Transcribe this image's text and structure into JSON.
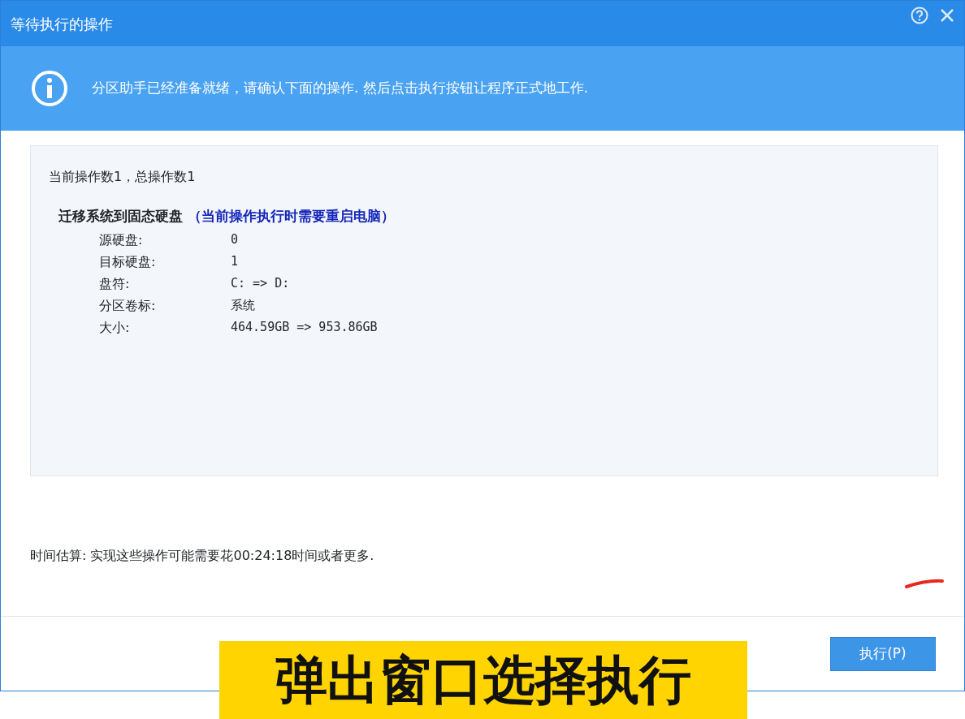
{
  "window": {
    "title": "等待执行的操作"
  },
  "info_banner": {
    "text": "分区助手已经准备就绪，请确认下面的操作. 然后点击执行按钮让程序正式地工作."
  },
  "operations": {
    "summary": "当前操作数1，总操作数1",
    "title": "迁移系统到固态硬盘",
    "note": "（当前操作执行时需要重启电脑）",
    "details": [
      {
        "label": "源硬盘:",
        "value": "0"
      },
      {
        "label": "目标硬盘:",
        "value": "1"
      },
      {
        "label": "盘符:",
        "value": "C: => D:"
      },
      {
        "label": "分区卷标:",
        "value": "系统"
      },
      {
        "label": "大小:",
        "value": "464.59GB => 953.86GB"
      }
    ]
  },
  "time_estimate": "时间估算: 实现这些操作可能需要花00:24:18时间或者更多.",
  "buttons": [
    "执行(P)"
  ],
  "caption": "弹出窗口选择执行"
}
